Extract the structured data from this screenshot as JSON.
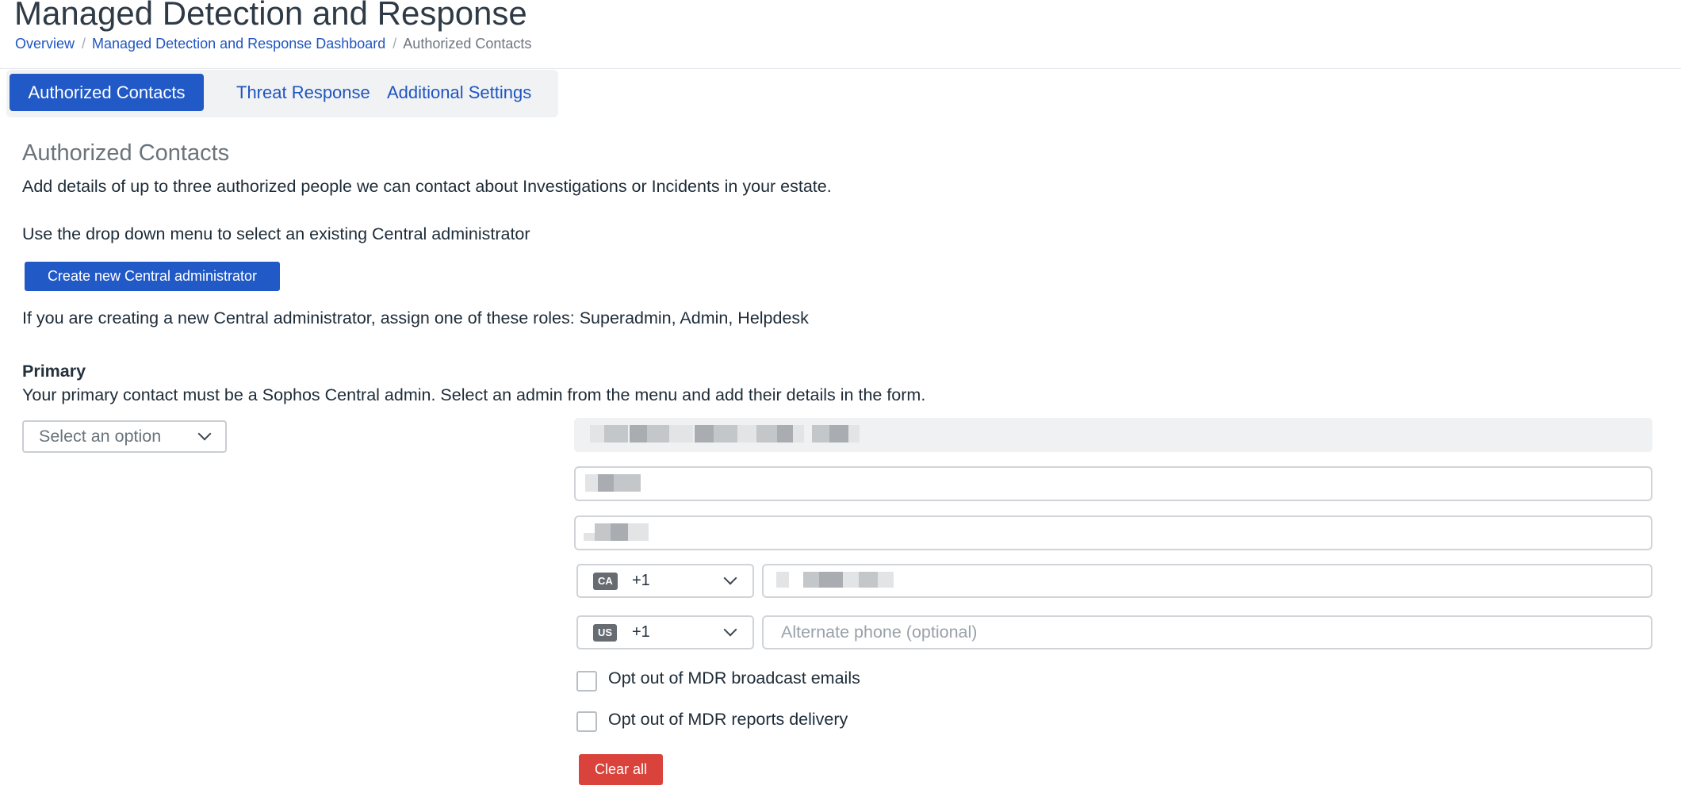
{
  "header": {
    "title": "Managed Detection and Response",
    "breadcrumb": {
      "items": [
        "Overview",
        "Managed Detection and Response Dashboard"
      ],
      "current": "Authorized Contacts",
      "separator": "/"
    }
  },
  "tabs": [
    {
      "label": "Authorized Contacts",
      "active": true
    },
    {
      "label": "Threat Response",
      "active": false
    },
    {
      "label": "Additional Settings",
      "active": false
    }
  ],
  "section": {
    "title": "Authorized Contacts",
    "description": "Add details of up to three authorized people we can contact about Investigations or Incidents in your estate.",
    "dropdown_hint": "Use the drop down menu to select an existing Central administrator",
    "create_button": "Create new Central administrator",
    "roles_hint": "If you are creating a new Central administrator, assign one of these roles: Superadmin, Admin, Helpdesk"
  },
  "primary": {
    "heading": "Primary",
    "description": "Your primary contact must be a Sophos Central admin. Select an admin from the menu and add their details in the form.",
    "select_placeholder": "Select an option",
    "phone": {
      "country": "CA",
      "dial_code": "+1"
    },
    "alt_phone": {
      "country": "US",
      "dial_code": "+1",
      "placeholder": "Alternate phone (optional)"
    },
    "checkboxes": [
      {
        "label": "Opt out of MDR broadcast emails",
        "checked": false
      },
      {
        "label": "Opt out of MDR reports delivery",
        "checked": false
      }
    ],
    "clear_button": "Clear all"
  },
  "colors": {
    "primary": "#2159c6",
    "link": "#1f55c0",
    "danger": "#d9433b",
    "badge": "#666c72"
  }
}
